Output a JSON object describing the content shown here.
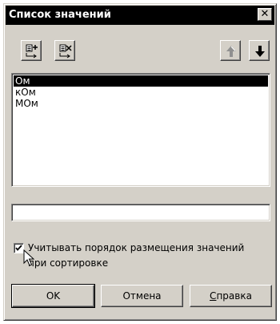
{
  "window": {
    "title": "Список значений",
    "close_glyph": "✕"
  },
  "toolbar": {
    "add_icon": "add-item-icon",
    "delete_icon": "delete-item-icon",
    "up_icon": "arrow-up-icon",
    "down_icon": "arrow-down-icon"
  },
  "list": {
    "items": [
      "Ом",
      "кОм",
      "МОм"
    ],
    "selected_index": 0
  },
  "value_input": {
    "value": ""
  },
  "checkbox": {
    "checked": true,
    "label_line1": "Учитывать порядок размещения значений",
    "label_line2": "при сортировке"
  },
  "buttons": {
    "ok": "OK",
    "cancel": "Отмена",
    "help_mnemonic": "С",
    "help_rest": "правка"
  }
}
